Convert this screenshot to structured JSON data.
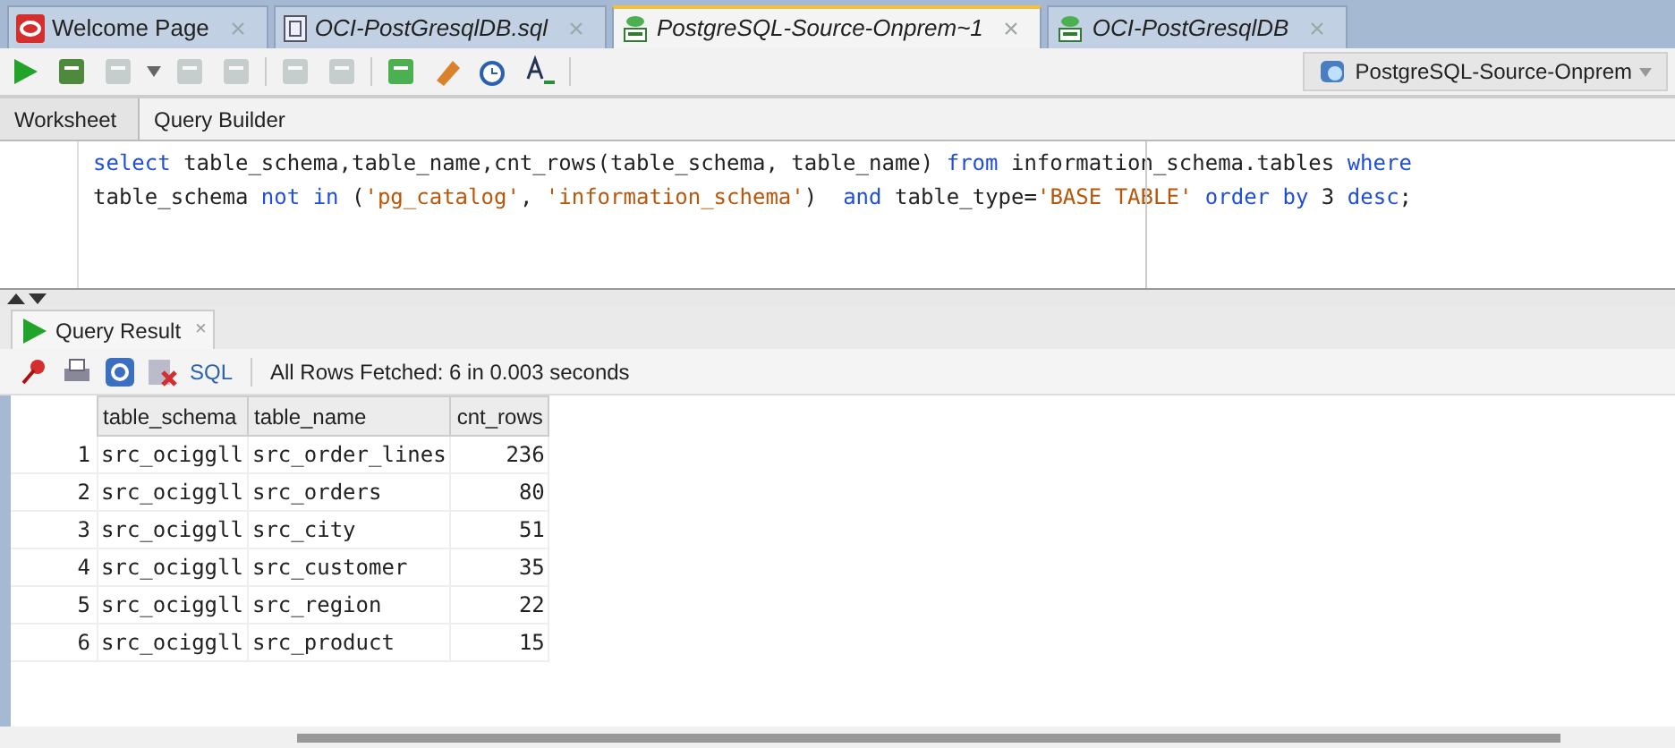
{
  "document_tabs": [
    {
      "label": "Welcome Page",
      "kind": "oracle",
      "selected": false
    },
    {
      "label": "OCI-PostGresqlDB.sql",
      "kind": "file",
      "selected": false
    },
    {
      "label": "PostgreSQL-Source-Onprem~1",
      "kind": "sql",
      "selected": true
    },
    {
      "label": "OCI-PostGresqlDB",
      "kind": "sql",
      "selected": false
    }
  ],
  "connection": {
    "label": "PostgreSQL-Source-Onprem"
  },
  "editor_tabs": [
    {
      "label": "Worksheet",
      "selected": true
    },
    {
      "label": "Query Builder",
      "selected": false
    }
  ],
  "sql_lines": [
    [
      {
        "text": "select",
        "kind": "keyword"
      },
      {
        "text": " table_schema,table_name,cnt_rows(table_schema, table_name) ",
        "kind": "plain"
      },
      {
        "text": "from",
        "kind": "keyword"
      },
      {
        "text": " information_schema.tables ",
        "kind": "plain"
      },
      {
        "text": "where",
        "kind": "keyword"
      }
    ],
    [
      {
        "text": "table_schema ",
        "kind": "plain"
      },
      {
        "text": "not in",
        "kind": "keyword"
      },
      {
        "text": " (",
        "kind": "plain"
      },
      {
        "text": "'pg_catalog'",
        "kind": "string"
      },
      {
        "text": ", ",
        "kind": "plain"
      },
      {
        "text": "'information_schema'",
        "kind": "string"
      },
      {
        "text": ")  ",
        "kind": "plain"
      },
      {
        "text": "and",
        "kind": "keyword"
      },
      {
        "text": " table_type=",
        "kind": "plain"
      },
      {
        "text": "'BASE TABLE'",
        "kind": "string"
      },
      {
        "text": " order by",
        "kind": "keyword"
      },
      {
        "text": " 3 ",
        "kind": "plain"
      },
      {
        "text": "desc",
        "kind": "keyword"
      },
      {
        "text": ";",
        "kind": "plain"
      }
    ]
  ],
  "result_tab": {
    "label": "Query Result",
    "close": "×"
  },
  "result_toolbar": {
    "sql_label": "SQL",
    "status": "All Rows Fetched: 6 in 0.003 seconds"
  },
  "table": {
    "columns": [
      "table_schema",
      "table_name",
      "cnt_rows"
    ],
    "rows": [
      {
        "number": "1",
        "cells": [
          "src_ociggll",
          "src_order_lines",
          "236"
        ]
      },
      {
        "number": "2",
        "cells": [
          "src_ociggll",
          "src_orders",
          "80"
        ]
      },
      {
        "number": "3",
        "cells": [
          "src_ociggll",
          "src_city",
          "51"
        ]
      },
      {
        "number": "4",
        "cells": [
          "src_ociggll",
          "src_customer",
          "35"
        ]
      },
      {
        "number": "5",
        "cells": [
          "src_ociggll",
          "src_region",
          "22"
        ]
      },
      {
        "number": "6",
        "cells": [
          "src_ociggll",
          "src_product",
          "15"
        ]
      }
    ]
  }
}
